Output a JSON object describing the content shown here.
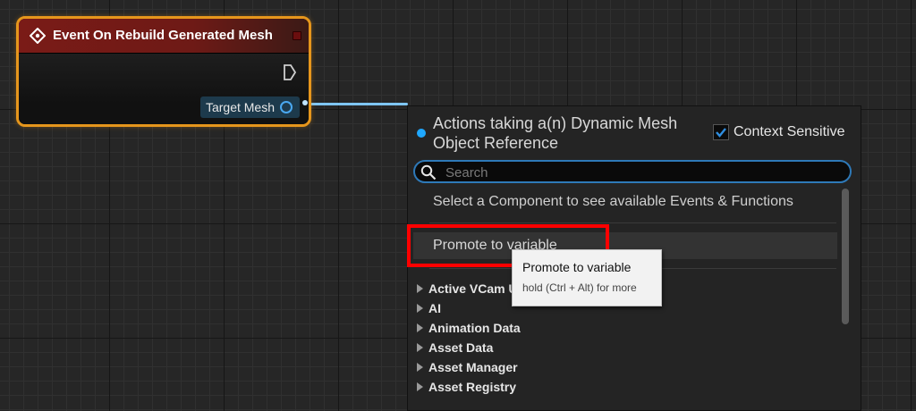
{
  "node": {
    "title": "Event On Rebuild Generated Mesh",
    "output_pin_label": "Target Mesh",
    "header_color": "#7a1b17",
    "border_color": "#e6961c"
  },
  "menu": {
    "title": "Actions taking a(n) Dynamic Mesh Object Reference",
    "context_sensitive_label": "Context Sensitive",
    "context_sensitive_checked": true,
    "search_placeholder": "Search",
    "hint": "Select a Component to see available Events & Functions",
    "promote_label": "Promote to variable",
    "categories": [
      "Active VCam U",
      "AI",
      "Animation Data",
      "Asset Data",
      "Asset Manager",
      "Asset Registry"
    ],
    "accent_color": "#1fa8ff"
  },
  "tooltip": {
    "title": "Promote to variable",
    "subtitle": "hold (Ctrl + Alt) for more"
  },
  "highlight_color": "#ff0000",
  "icons": [
    "event-diamond-icon",
    "exec-pin-icon",
    "object-pin-icon",
    "checkmark-icon",
    "search-icon",
    "expand-triangle-icon"
  ]
}
